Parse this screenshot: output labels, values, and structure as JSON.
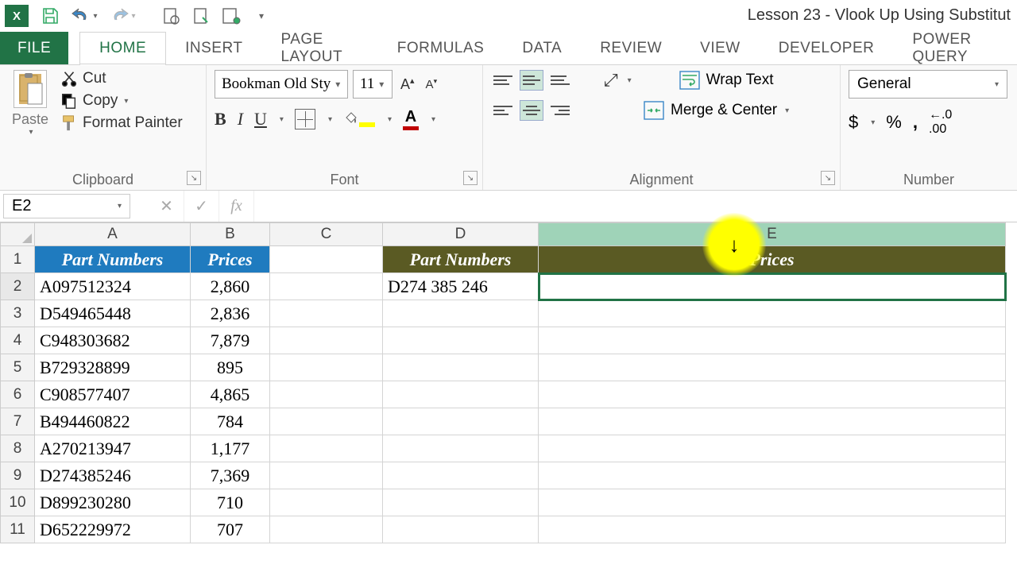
{
  "window": {
    "title": "Lesson 23 - Vlook Up Using Substitut"
  },
  "tabs": {
    "file": "FILE",
    "home": "HOME",
    "insert": "INSERT",
    "page_layout": "PAGE LAYOUT",
    "formulas": "FORMULAS",
    "data": "DATA",
    "review": "REVIEW",
    "view": "VIEW",
    "developer": "DEVELOPER",
    "power_query": "POWER QUERY"
  },
  "ribbon": {
    "clipboard": {
      "label": "Clipboard",
      "paste": "Paste",
      "cut": "Cut",
      "copy": "Copy",
      "format_painter": "Format Painter"
    },
    "font": {
      "label": "Font",
      "family": "Bookman Old Sty",
      "size": "11",
      "increase": "A",
      "decrease": "A"
    },
    "alignment": {
      "label": "Alignment",
      "wrap": "Wrap Text",
      "merge": "Merge & Center"
    },
    "number": {
      "label": "Number",
      "format": "General",
      "currency": "$",
      "percent": "%",
      "comma": ","
    }
  },
  "formula_bar": {
    "namebox": "E2",
    "formula": ""
  },
  "columns": {
    "A": "A",
    "B": "B",
    "C": "C",
    "D": "D",
    "E": "E"
  },
  "headers_left": {
    "part": "Part Numbers",
    "price": "Prices"
  },
  "headers_right": {
    "part": "Part Numbers",
    "price": "Prices"
  },
  "lookup_value": "D274 385 246",
  "table": [
    {
      "part": "A097512324",
      "price": "2,860"
    },
    {
      "part": "D549465448",
      "price": "2,836"
    },
    {
      "part": "C948303682",
      "price": "7,879"
    },
    {
      "part": "B729328899",
      "price": "895"
    },
    {
      "part": "C908577407",
      "price": "4,865"
    },
    {
      "part": "B494460822",
      "price": "784"
    },
    {
      "part": "A270213947",
      "price": "1,177"
    },
    {
      "part": "D274385246",
      "price": "7,369"
    },
    {
      "part": "D899230280",
      "price": "710"
    },
    {
      "part": "D652229972",
      "price": "707"
    }
  ],
  "row_numbers": [
    "1",
    "2",
    "3",
    "4",
    "5",
    "6",
    "7",
    "8",
    "9",
    "10",
    "11"
  ]
}
